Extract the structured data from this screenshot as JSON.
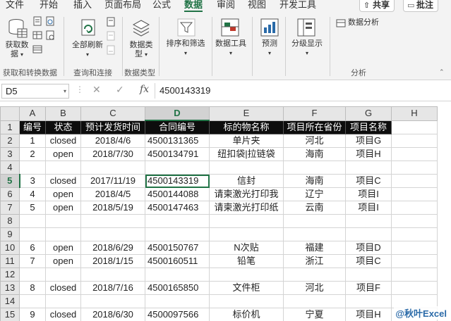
{
  "ribbon_tabs": {
    "file": "文件",
    "home": "开始",
    "insert": "插入",
    "page_layout": "页面布局",
    "formulas": "公式",
    "data": "数据",
    "review": "审阅",
    "view": "视图",
    "developer": "开发工具",
    "share": "共享",
    "comments": "批注"
  },
  "ribbon": {
    "get_data_1": "获取数",
    "get_data_2": "据",
    "refresh_all": "全部刷新",
    "data_types_1": "数据类",
    "data_types_2": "型",
    "sort_filter": "排序和筛选",
    "data_tools": "数据工具",
    "forecast": "预测",
    "outline": "分级显示",
    "data_analysis": "数据分析",
    "group_get_transform": "获取和转换数据",
    "group_queries": "查询和连接",
    "group_data_types": "数据类型",
    "group_analysis": "分析"
  },
  "formula_bar": {
    "name_box": "D5",
    "fx": "fx",
    "value": "4500143319"
  },
  "columns": [
    "A",
    "B",
    "C",
    "D",
    "E",
    "F",
    "G",
    "H"
  ],
  "rows": [
    {
      "n": "1",
      "cells": [
        "编号",
        "状态",
        "预计发货时间",
        "合同编号",
        "标的物名称",
        "项目所在省份",
        "项目名称",
        ""
      ]
    },
    {
      "n": "2",
      "cells": [
        "1",
        "closed",
        "2018/4/6",
        "4500131365",
        "单片夹",
        "河北",
        "项目G",
        ""
      ]
    },
    {
      "n": "3",
      "cells": [
        "2",
        "open",
        "2018/7/30",
        "4500134791",
        "纽扣袋|拉链袋",
        "海南",
        "项目H",
        ""
      ]
    },
    {
      "n": "4",
      "cells": [
        "",
        "",
        "",
        "",
        "",
        "",
        "",
        ""
      ]
    },
    {
      "n": "5",
      "cells": [
        "3",
        "closed",
        "2017/11/19",
        "4500143319",
        "信封",
        "海南",
        "项目C",
        ""
      ]
    },
    {
      "n": "6",
      "cells": [
        "4",
        "open",
        "2018/4/5",
        "4500144088",
        "请柬激光打印我",
        "辽宁",
        "项目I",
        ""
      ]
    },
    {
      "n": "7",
      "cells": [
        "5",
        "open",
        "2018/5/19",
        "4500147463",
        "请柬激光打印纸",
        "云南",
        "项目I",
        ""
      ]
    },
    {
      "n": "8",
      "cells": [
        "",
        "",
        "",
        "",
        "",
        "",
        "",
        ""
      ]
    },
    {
      "n": "9",
      "cells": [
        "",
        "",
        "",
        "",
        "",
        "",
        "",
        ""
      ]
    },
    {
      "n": "10",
      "cells": [
        "6",
        "open",
        "2018/6/29",
        "4500150767",
        "N次贴",
        "福建",
        "项目D",
        ""
      ]
    },
    {
      "n": "11",
      "cells": [
        "7",
        "open",
        "2018/1/15",
        "4500160511",
        "铅笔",
        "浙江",
        "项目C",
        ""
      ]
    },
    {
      "n": "12",
      "cells": [
        "",
        "",
        "",
        "",
        "",
        "",
        "",
        ""
      ]
    },
    {
      "n": "13",
      "cells": [
        "8",
        "closed",
        "2018/7/16",
        "4500165850",
        "文件柜",
        "河北",
        "项目F",
        ""
      ]
    },
    {
      "n": "14",
      "cells": [
        "",
        "",
        "",
        "",
        "",
        "",
        "",
        ""
      ]
    },
    {
      "n": "15",
      "cells": [
        "9",
        "closed",
        "2018/6/30",
        "4500097566",
        "标价机",
        "宁夏",
        "项目H",
        ""
      ]
    }
  ],
  "watermark": "@秋叶Excel",
  "colors": {
    "accent": "#217346",
    "header_fill": "#0d0d0d",
    "header_text": "#ffffff"
  }
}
